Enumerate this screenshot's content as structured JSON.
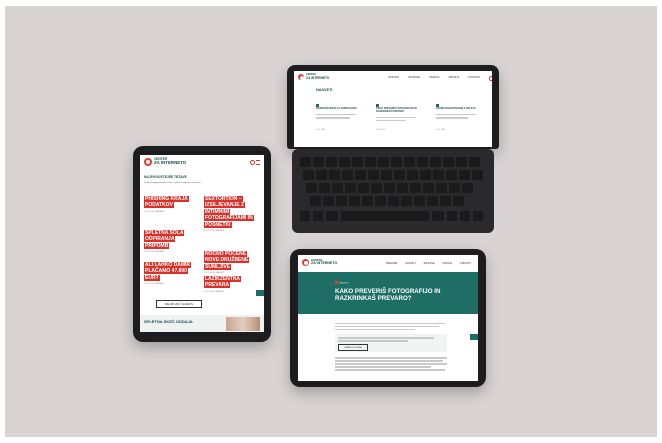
{
  "site": {
    "logo_line1": "CENTER",
    "logo_line2": "ZA INTERNETO",
    "tagline": "Varnejši internet za vse"
  },
  "tablet_left": {
    "banner_title": "NAJPOGOSTEJŠE TEŽAVE",
    "banner_sub": "Pregled najpogostejših težav v spletu z odgovori in nasveti",
    "articles": [
      {
        "title": "PHISHING KRAJA PODATKOV",
        "meta": "3. 10. 2020 | NASVETI"
      },
      {
        "title": "SEXTORTION – IZSILJEVANJE Z INTIMNIMI FOTOGRAFIJAMI IN POSNETKI",
        "meta": "3. 10. 2020 | NASVETI"
      },
      {
        "title": "SPLETNA ŠOLA ODPIRANJA PRIPOMB",
        "meta": "3. 10. 2020 | NASVETI"
      },
      {
        "title": "NOČNO POČENE NOVE DRUŽBENE SUMLJIVE",
        "meta": "3. 10. 2020 | NASVETI"
      },
      {
        "title": "ALI LAHKO DAMIR PLAČAMO 47.800 EUR?",
        "meta": "3. 10. 2020 | NASVETI"
      },
      {
        "title": "LAŽIKZENTNA PREVARA",
        "meta": "3. 10. 2020 | NASVETI"
      }
    ],
    "more_button": "NALOŽI VEČ ČLANKOV",
    "section_title": "SPLETNA SKEČ ODDAJA"
  },
  "laptop": {
    "nav": [
      "NASVETI",
      "SPLETNE",
      "ODDAJA",
      "ORODJA",
      "KONTAKT"
    ],
    "heading": "NASVETI",
    "cards": [
      {
        "title": "IZOBRAŽEVANJE ZA VARNO RABO",
        "meta": "3. 10. 2020"
      },
      {
        "title": "KAKO PREVERIŠ FOTOGRAFIJO IN RAZKRINKAŠ PREVARO",
        "meta": "3. 10. 2020"
      },
      {
        "title": "VARNO NAKUPOVANJE V SPLETU",
        "meta": "3. 10. 2020"
      }
    ]
  },
  "tablet_right": {
    "nav": [
      "PREVARE",
      "NASVETI",
      "SPLETNE",
      "ODDAJA",
      "KONTAKT"
    ],
    "category": "NASVETI",
    "hero_title": "KAKO PREVERIŠ FOTOGRAFIJO IN RAZKRINKAŠ PREVARO?",
    "search_button": "ISKANJE PO SLIKAH"
  },
  "colors": {
    "brand_teal": "#1b4d4a",
    "accent_red": "#d8322a",
    "hero_teal": "#1f6e66",
    "device_black": "#1d1d1f",
    "backdrop": "#d9d4d3"
  }
}
